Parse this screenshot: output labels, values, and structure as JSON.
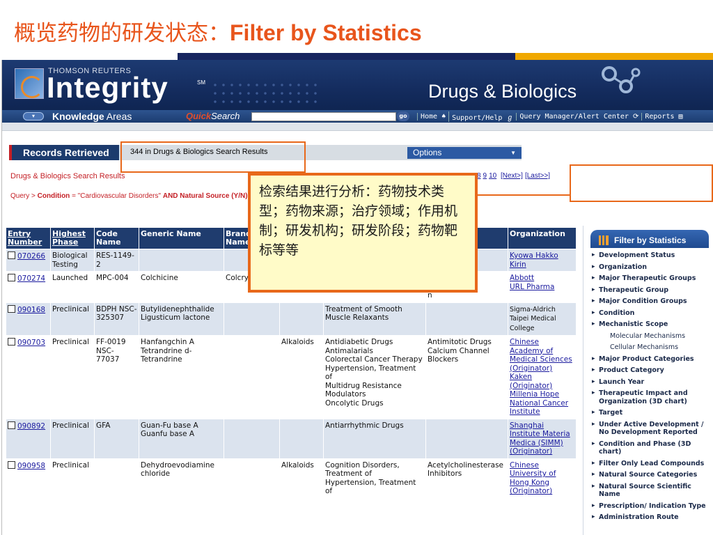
{
  "slide": {
    "title_cn": "概览药物的研发状态：",
    "title_en": "Filter by Statistics"
  },
  "brand": {
    "top": "THOMSON REUTERS",
    "main": "Integrity",
    "sm": "SM",
    "product": "Drugs & Biologics"
  },
  "nav": {
    "knowledge_bold": "Knowledge",
    "knowledge_rest": " Areas",
    "quick": "Quick",
    "search": "Search",
    "go": "go",
    "links": [
      "Home ♠",
      "Support/Help ℊ",
      "Query Manager/Alert Center ⟳",
      "Reports ▤"
    ]
  },
  "records": {
    "title": "Records Retrieved",
    "count": "344  in Drugs & Biologics Search Results",
    "options": "Options",
    "subhead": "Drugs & Biologics Search Results",
    "pages": [
      "1",
      "2",
      "3",
      "4",
      "5",
      "6",
      "7",
      "8",
      "9",
      "10"
    ],
    "next": "[Next>]",
    "last": "[Last>>]"
  },
  "query": {
    "prefix": "Query > ",
    "field1": "Condition",
    "val1": " = \"Cardiovascular Disorders\" ",
    "and": "AND",
    "field2": "Natural Source (Y/N)",
    "val2": " = Y"
  },
  "table": {
    "headers": [
      "Entry Number",
      "Highest Phase",
      "Code Name",
      "Generic Name",
      "Brand Name",
      "",
      "",
      "of",
      "Organization"
    ],
    "rows": [
      {
        "entry": "070266",
        "phase": "Biological Testing",
        "code": "RES-1149-2",
        "generic": "",
        "brand": "",
        "source": "",
        "cond": "",
        "mech": "D",
        "org": "Kyowa Hakko Kirin"
      },
      {
        "entry": "070274",
        "phase": "Launched",
        "code": "MPC-004",
        "generic": "Colchicine",
        "brand": "Colcry Colsta",
        "source": "",
        "cond": "",
        "mech": "rugs\n\nn",
        "org": "Abbott\nURL Pharma"
      },
      {
        "entry": "090168",
        "phase": "Preclinical",
        "code": "BDPH NSC-325307",
        "generic": "Butylidenephthalide Ligusticum lactone",
        "brand": "",
        "source": "",
        "cond": "Treatment of Smooth Muscle Relaxants",
        "mech": "",
        "org": "Sigma-Aldrich Taipei Medical College"
      },
      {
        "entry": "090703",
        "phase": "Preclinical",
        "code": "FF-0019 NSC-77037",
        "generic": "Hanfangchin A Tetrandrine d-Tetrandrine",
        "brand": "",
        "source": "Alkaloids",
        "cond": "Antidiabetic Drugs\nAntimalarials\nColorectal Cancer Therapy\nHypertension, Treatment of\nMultidrug Resistance Modulators\nOncolytic Drugs",
        "mech": "Antimitotic Drugs\nCalcium Channel Blockers",
        "org": "Chinese Academy of Medical Sciences (Originator)\nKaken (Originator)\nMillenia Hope\nNational Cancer Institute"
      },
      {
        "entry": "090892",
        "phase": "Preclinical",
        "code": "GFA",
        "generic": "Guan-Fu base A Guanfu base A",
        "brand": "",
        "source": "",
        "cond": "Antiarrhythmic Drugs",
        "mech": "",
        "org": "Shanghai Institute Materia Medica (SIMM) (Originator)"
      },
      {
        "entry": "090958",
        "phase": "Preclinical",
        "code": "",
        "generic": "Dehydroevodiamine chloride",
        "brand": "",
        "source": "Alkaloids",
        "cond": "Cognition Disorders, Treatment of\nHypertension, Treatment of",
        "mech": "Acetylcholinesterase Inhibitors",
        "org": "Chinese University of Hong Kong (Originator)"
      }
    ]
  },
  "filter_panel": {
    "title": "Filter by Statistics",
    "items": [
      {
        "label": "Development Status",
        "sub": false
      },
      {
        "label": "Organization",
        "sub": false
      },
      {
        "label": "Major Therapeutic Groups",
        "sub": false
      },
      {
        "label": "Therapeutic Group",
        "sub": false
      },
      {
        "label": "Major Condition Groups",
        "sub": false
      },
      {
        "label": "Condition",
        "sub": false
      },
      {
        "label": "Mechanistic Scope",
        "sub": false
      },
      {
        "label": "Molecular Mechanisms",
        "sub": true
      },
      {
        "label": "Cellular Mechanisms",
        "sub": true
      },
      {
        "label": "Major Product Categories",
        "sub": false
      },
      {
        "label": "Product Category",
        "sub": false
      },
      {
        "label": "Launch Year",
        "sub": false
      },
      {
        "label": "Therapeutic Impact and Organization (3D chart)",
        "sub": false
      },
      {
        "label": "Target",
        "sub": false
      },
      {
        "label": "Under Active Development / No Development Reported",
        "sub": false
      },
      {
        "label": "Condition and Phase (3D chart)",
        "sub": false
      },
      {
        "label": "Filter Only Lead Compounds",
        "sub": false
      },
      {
        "label": "Natural Source Categories",
        "sub": false
      },
      {
        "label": "Natural Source Scientific Name",
        "sub": false
      },
      {
        "label": "Prescription/ Indication Type",
        "sub": false
      },
      {
        "label": "Administration Route",
        "sub": false
      }
    ]
  },
  "callout": {
    "text": "检索结果进行分析：药物技术类型；药物来源；治疗领域；作用机制；研发机构；研发阶段；药物靶标等等"
  },
  "colors": {
    "accent_orange": "#e8681a",
    "title_orange": "#e8551c",
    "navy": "#1f3c6e",
    "link_blue": "#1a1a9e",
    "red": "#c42026"
  }
}
